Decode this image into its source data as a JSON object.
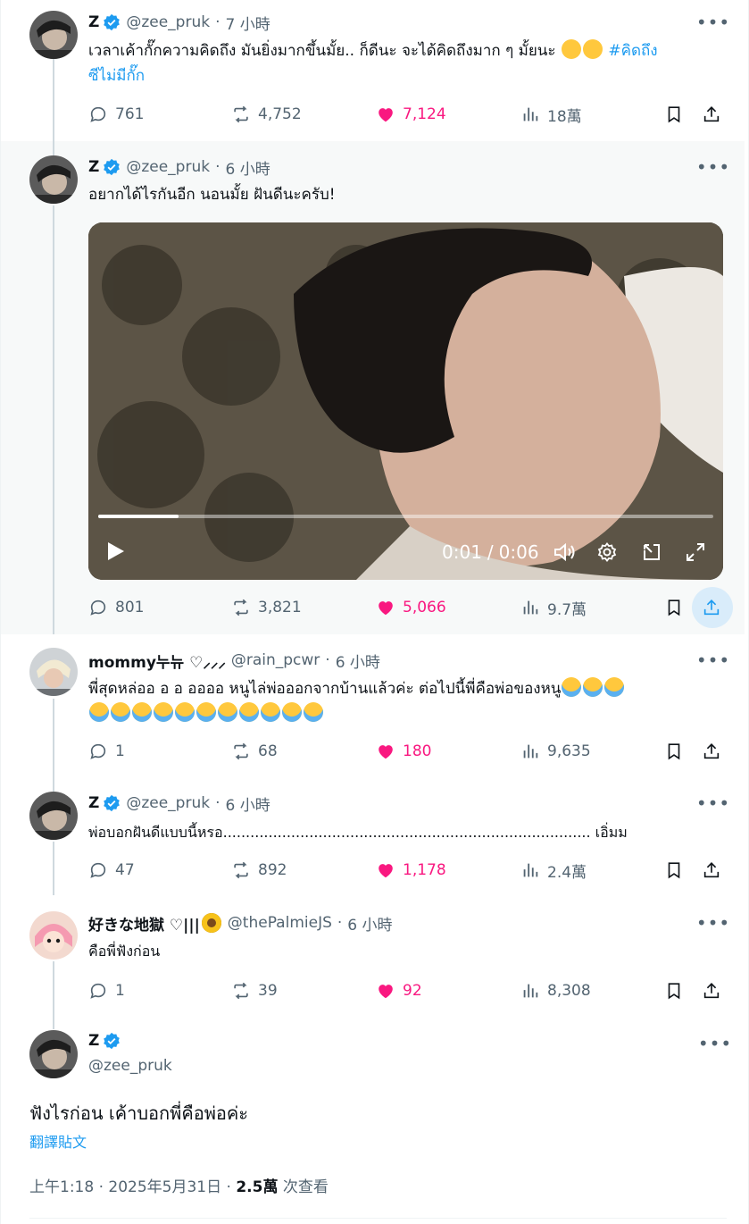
{
  "colors": {
    "accent": "#1d9bf0",
    "like": "#f91880",
    "muted": "#536471",
    "text": "#0f1419",
    "highlight_bg": "#f7f9f9"
  },
  "posts": [
    {
      "name": "Z",
      "verified": true,
      "handle": "@zee_pruk",
      "sep": "·",
      "time": "7 小時",
      "text": "เวลาเค้ากั๊กความคิดถึง มันยิ่งมากขึ้นมั้ย.. ก็ดีนะ จะได้คิดถึงมาก ๆ มั้ยนะ",
      "emojis": [
        "upside-down-face-emoji",
        "grinning-squinting-face-emoji"
      ],
      "hashtag_line1": "#คิดถึง",
      "hashtag_line2": "ซีไม่มีกั๊ก",
      "stats": {
        "replies": "761",
        "reposts": "4,752",
        "likes": "7,124",
        "views": "18萬"
      }
    },
    {
      "name": "Z",
      "verified": true,
      "handle": "@zee_pruk",
      "sep": "·",
      "time": "6 小時",
      "text": "อยากได้ไรกันอีก นอนมั้ย ฝันดีนะครับ!",
      "video": {
        "current": "0:01",
        "separator": "/",
        "duration": "0:06",
        "progress": 0.13
      },
      "stats": {
        "replies": "801",
        "reposts": "3,821",
        "likes": "5,066",
        "views": "9.7萬"
      }
    },
    {
      "name": "mommy누뉴 ♡⸝⸝⸝",
      "verified": false,
      "handle": "@rain_pcwr",
      "sep": "·",
      "time": "6 小時",
      "text": "พี่สุดหล่ออ อ อ ออออ หนูไล่พ่อออกจากบ้านแล้วค่ะ ต่อไปนี้พี่คือพ่อของหนู",
      "emojis_line1_count": 3,
      "emojis_line2_count": 11,
      "emoji_name": "loudly-crying-face-emoji",
      "stats": {
        "replies": "1",
        "reposts": "68",
        "likes": "180",
        "views": "9,635"
      }
    },
    {
      "name": "Z",
      "verified": true,
      "handle": "@zee_pruk",
      "sep": "·",
      "time": "6 小時",
      "text": "พ่อบอกฝันดีแบบนี้หรอ................................................................................. เอิ่มม",
      "stats": {
        "replies": "47",
        "reposts": "892",
        "likes": "1,178",
        "views": "2.4萬"
      }
    },
    {
      "name": "好きな地獄 ♡|||",
      "verified": false,
      "handle": "@thePalmieJS",
      "sep": "·",
      "time": "6 小時",
      "text": "คือพี่ฟังก่อน",
      "name_emoji": "sunflower-emoji",
      "stats": {
        "replies": "1",
        "reposts": "39",
        "likes": "92",
        "views": "8,308"
      }
    }
  ],
  "focused": {
    "name": "Z",
    "verified": true,
    "handle": "@zee_pruk",
    "text": "ฟังไรก่อน เค้าบอกพี่คือพ่อค่ะ",
    "translate": "翻譯貼文",
    "time": "上午1:18",
    "sep1": "·",
    "date": "2025年5月31日",
    "sep2": "·",
    "views": "2.5萬",
    "views_label": "次查看"
  }
}
